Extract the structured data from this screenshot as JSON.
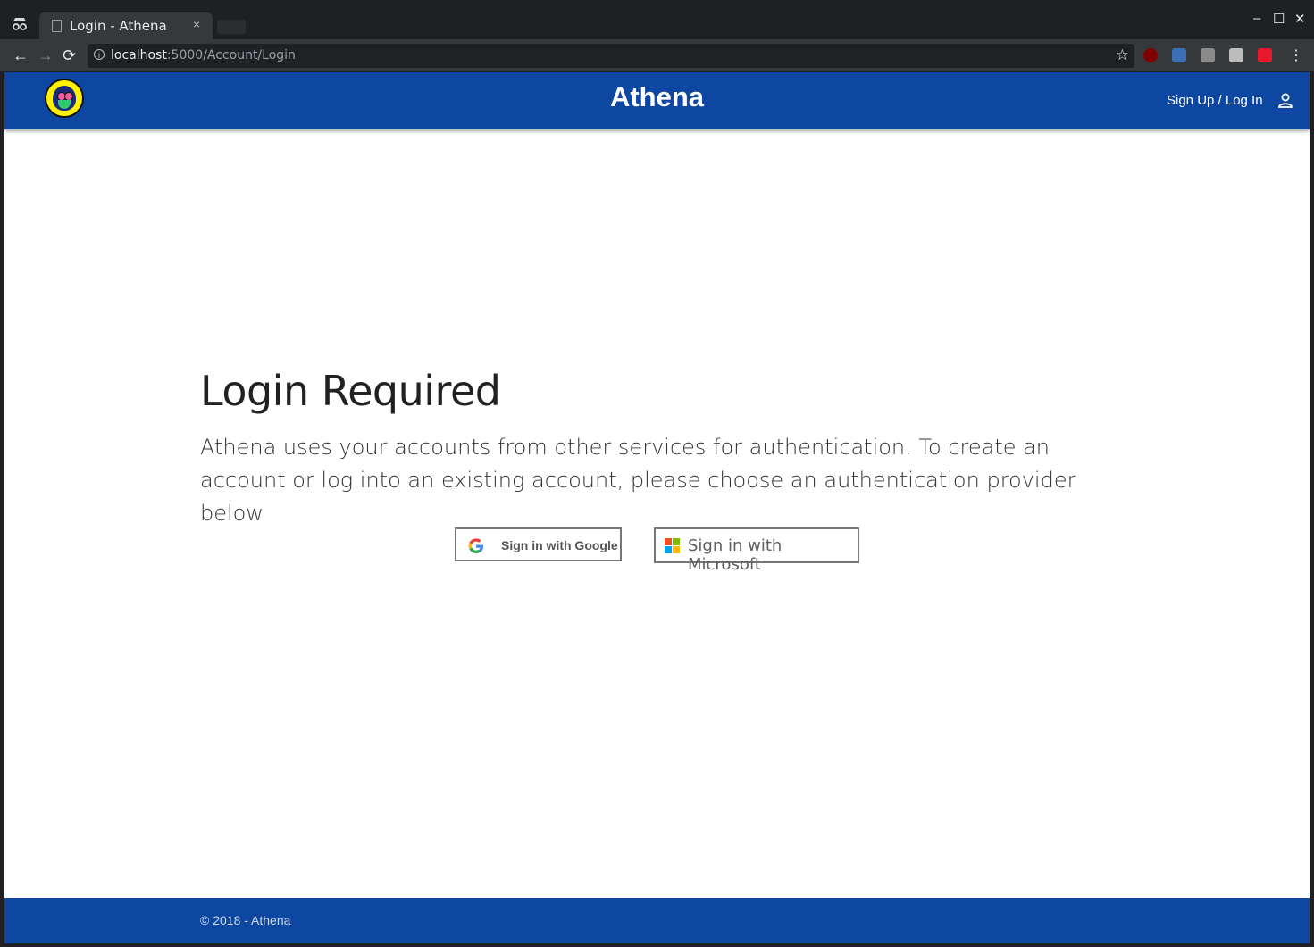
{
  "browser": {
    "tab_title": "Login - Athena",
    "tab_close": "×",
    "url_host": "localhost",
    "url_path": ":5000/Account/Login",
    "back": "←",
    "forward": "→",
    "reload": "⟳",
    "star": "☆",
    "minimize": "–",
    "maximize": "☐",
    "close": "✕",
    "menu": "⋮"
  },
  "app": {
    "brand": "Athena",
    "signup_login": "Sign Up / Log In",
    "accent_color": "#0d47a1"
  },
  "main": {
    "heading": "Login Required",
    "lead": "Athena uses your accounts from other services for authentication. To create an account or log into an existing account, please choose an authentication provider below",
    "google_button": "Sign in with Google",
    "microsoft_button": "Sign in with Microsoft"
  },
  "footer": {
    "copyright": "© 2018 - Athena"
  }
}
